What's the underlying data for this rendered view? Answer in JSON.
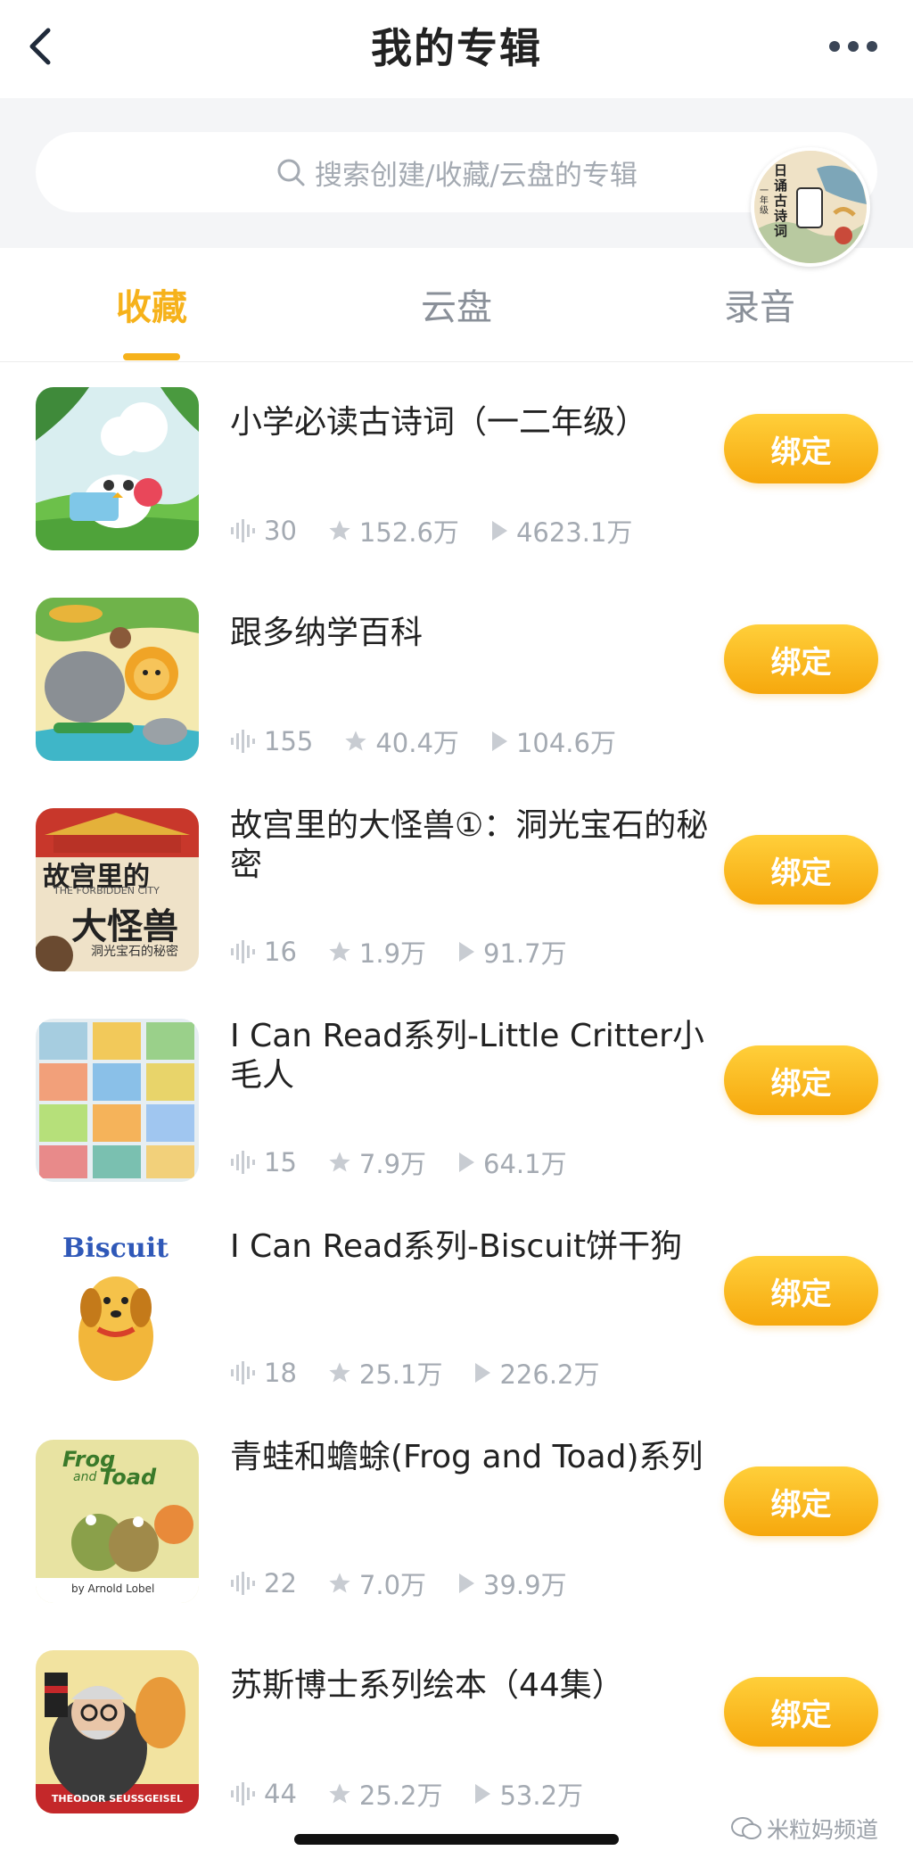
{
  "header": {
    "title": "我的专辑",
    "back_icon": "back-chevron-icon",
    "more_icon": "more-dots-icon"
  },
  "search": {
    "placeholder": "搜索创建/收藏/云盘的专辑"
  },
  "floating_player": {
    "cover_text": "日诵古诗词",
    "grade_text": "一年级"
  },
  "tabs": [
    {
      "label": "收藏",
      "active": true
    },
    {
      "label": "云盘",
      "active": false
    },
    {
      "label": "录音",
      "active": false
    }
  ],
  "albums": [
    {
      "title": "小学必读古诗词（一二年级）",
      "tracks": "30",
      "favorites": "152.6万",
      "plays": "4623.1万",
      "button": "绑定"
    },
    {
      "title": "跟多纳学百科",
      "tracks": "155",
      "favorites": "40.4万",
      "plays": "104.6万",
      "button": "绑定"
    },
    {
      "title": "故宫里的大怪兽①：洞光宝石的秘密",
      "tracks": "16",
      "favorites": "1.9万",
      "plays": "91.7万",
      "button": "绑定"
    },
    {
      "title": "I Can Read系列-Little Critter小毛人",
      "tracks": "15",
      "favorites": "7.9万",
      "plays": "64.1万",
      "button": "绑定"
    },
    {
      "title": "I Can Read系列-Biscuit饼干狗",
      "tracks": "18",
      "favorites": "25.1万",
      "plays": "226.2万",
      "button": "绑定"
    },
    {
      "title": "青蛙和蟾蜍(Frog and Toad)系列",
      "tracks": "22",
      "favorites": "7.0万",
      "plays": "39.9万",
      "button": "绑定"
    },
    {
      "title": "苏斯博士系列绘本（44集）",
      "tracks": "44",
      "favorites": "25.2万",
      "plays": "53.2万",
      "button": "绑定"
    }
  ],
  "covers": {
    "c2": "故宫里的",
    "c2b": "大怪兽",
    "c2sub": "THE FORBIDDEN CITY",
    "c2tag": "洞光宝石的秘密",
    "c4": "Biscuit",
    "c5a": "Frog",
    "c5b": "and",
    "c5c": "Toad",
    "c5d": "by Arnold Lobel",
    "c6": "THEODOR SEUSSGEISEL"
  },
  "watermark": "米粒妈频道",
  "colors": {
    "accent": "#f6b21b",
    "button_gradient_top": "#ffcf3a",
    "button_gradient_bottom": "#f6a80d",
    "muted_text": "#a4aab2"
  }
}
